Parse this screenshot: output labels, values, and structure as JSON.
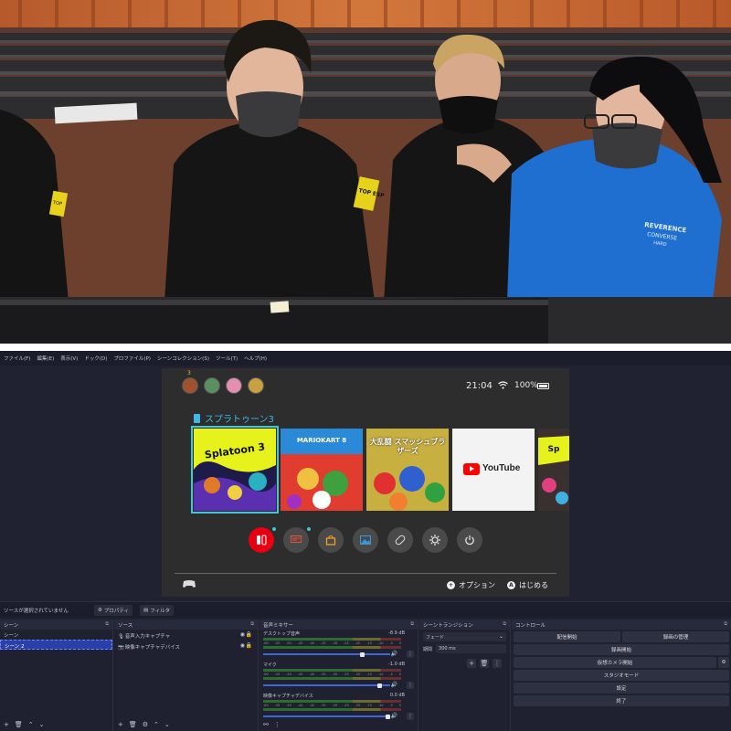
{
  "colors": {
    "obs_bg": "#1f2130",
    "accent_blue": "#3d66d8",
    "switch_cyan": "#3eb8e6",
    "switch_red": "#e60012",
    "youtube_red": "#ff0000"
  },
  "photo": {
    "patch_text": "TOP ESP",
    "jacket_text_1": "REVERENCE",
    "jacket_text_2": "CONVERSE",
    "jacket_text_3": "HARD"
  },
  "menubar": {
    "items": [
      "ファイル(F)",
      "編集(E)",
      "表示(V)",
      "ドック(D)",
      "プロファイル(P)",
      "シーンコレクション(S)",
      "ツール(T)",
      "ヘルプ(H)"
    ]
  },
  "switch": {
    "time": "21:04",
    "battery": "100%",
    "selected_game": "スプラトゥーン3",
    "avatar_badge": "3",
    "tiles": [
      {
        "name": "Splatoon 3",
        "label": "Splatoon 3"
      },
      {
        "name": "Mario Kart 8 Deluxe",
        "label": "MARIOKART 8"
      },
      {
        "name": "Super Smash Bros",
        "label": "大乱闘 スマッシュブラザーズ"
      },
      {
        "name": "YouTube",
        "label": "YouTube"
      },
      {
        "name": "Splatoon",
        "label": "Sp"
      }
    ],
    "system_buttons": [
      "online-icon",
      "news-icon",
      "eshop-icon",
      "album-icon",
      "controller-icon",
      "settings-icon",
      "power-icon"
    ],
    "options_label": "オプション",
    "start_label": "はじめる",
    "options_key": "+",
    "start_key": "A"
  },
  "statusbar": {
    "no_source": "ソースが選択されていません",
    "properties": "プロパティ",
    "filters": "フィルタ"
  },
  "scenes": {
    "title": "シーン",
    "items": [
      "シーン",
      "シーン 2"
    ]
  },
  "sources": {
    "title": "ソース",
    "items": [
      "音声入力キャプチャ",
      "映像キャプチャデバイス"
    ]
  },
  "mixer": {
    "title": "音声ミキサー",
    "channels": [
      {
        "name": "デスクトップ音声",
        "db": "-8.9 dB",
        "fader": 0.78
      },
      {
        "name": "マイク",
        "db": "-1.0 dB",
        "fader": 0.92
      },
      {
        "name": "映像キャプチャデバイス",
        "db": "0.0 dB",
        "fader": 0.98
      }
    ],
    "scale": [
      "-60",
      "-55",
      "-50",
      "-45",
      "-40",
      "-35",
      "-30",
      "-25",
      "-20",
      "-15",
      "-10",
      "-5",
      "0"
    ]
  },
  "transitions": {
    "title": "シーントランジション",
    "type": "フェード",
    "duration_label": "期間",
    "duration_value": "300 ms"
  },
  "controls": {
    "title": "コントロール",
    "start_stream": "配信開始",
    "start_record": "録画の管理",
    "record": "録画開始",
    "virtual_cam": "仮想カメラ開始",
    "studio_mode": "スタジオモード",
    "settings": "設定",
    "exit": "終了"
  }
}
